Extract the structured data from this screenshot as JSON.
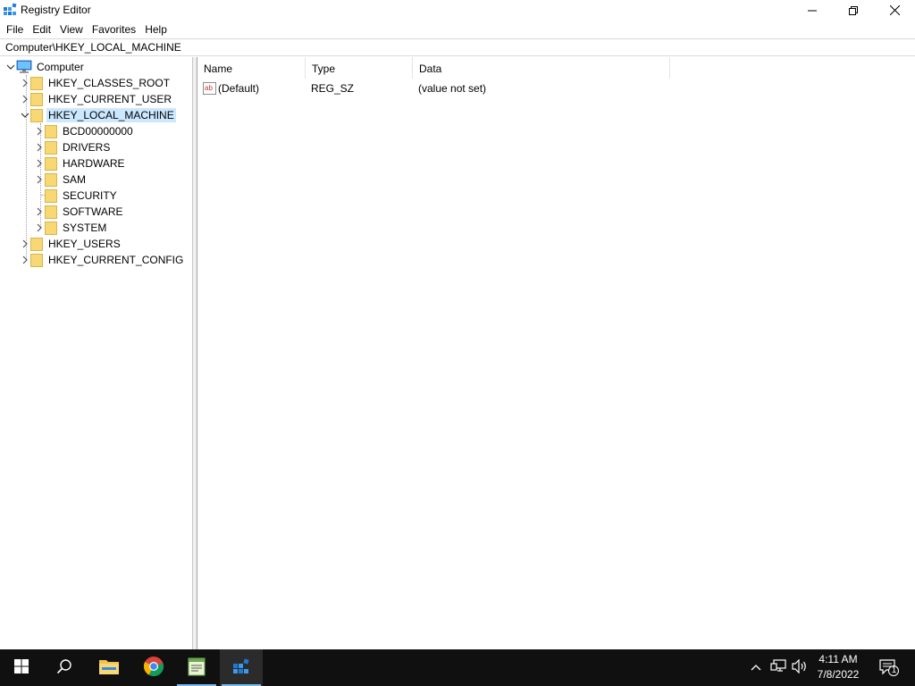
{
  "window": {
    "title": "Registry Editor",
    "icon": "registry-editor-icon"
  },
  "menu": [
    {
      "label": "File"
    },
    {
      "label": "Edit"
    },
    {
      "label": "View"
    },
    {
      "label": "Favorites"
    },
    {
      "label": "Help"
    }
  ],
  "address": {
    "path": "Computer\\HKEY_LOCAL_MACHINE"
  },
  "tree": {
    "root": {
      "label": "Computer",
      "icon": "computer-icon",
      "expanded": true
    },
    "hives": [
      {
        "label": "HKEY_CLASSES_ROOT",
        "expanded": false
      },
      {
        "label": "HKEY_CURRENT_USER",
        "expanded": false
      },
      {
        "label": "HKEY_LOCAL_MACHINE",
        "expanded": true,
        "selected": true
      },
      {
        "label": "HKEY_USERS",
        "expanded": false
      },
      {
        "label": "HKEY_CURRENT_CONFIG",
        "expanded": false
      }
    ],
    "hklm_children": [
      {
        "label": "BCD00000000",
        "has_children": true
      },
      {
        "label": "DRIVERS",
        "has_children": true
      },
      {
        "label": "HARDWARE",
        "has_children": true
      },
      {
        "label": "SAM",
        "has_children": true
      },
      {
        "label": "SECURITY",
        "has_children": false
      },
      {
        "label": "SOFTWARE",
        "has_children": true
      },
      {
        "label": "SYSTEM",
        "has_children": true
      }
    ]
  },
  "list": {
    "columns": [
      {
        "label": "Name"
      },
      {
        "label": "Type"
      },
      {
        "label": "Data"
      }
    ],
    "rows": [
      {
        "icon": "string-value-icon",
        "name": "(Default)",
        "type": "REG_SZ",
        "data": "(value not set)"
      }
    ]
  },
  "taskbar": {
    "apps": [
      {
        "name": "start-button",
        "icon": "windows-logo-icon"
      },
      {
        "name": "search-button",
        "icon": "search-icon"
      },
      {
        "name": "file-explorer",
        "icon": "folder-icon"
      },
      {
        "name": "chrome",
        "icon": "chrome-icon"
      },
      {
        "name": "notepad-plus",
        "icon": "notepad-icon"
      },
      {
        "name": "registry-editor",
        "icon": "registry-editor-icon",
        "active": true
      }
    ],
    "clock": {
      "time": "4:11 AM",
      "date": "7/8/2022"
    },
    "notifications": {
      "count": "1"
    }
  },
  "colors": {
    "selection": "#cce8ff",
    "folder": "#f8d775",
    "taskbar": "#101010",
    "active_underline": "#76b9ed"
  }
}
